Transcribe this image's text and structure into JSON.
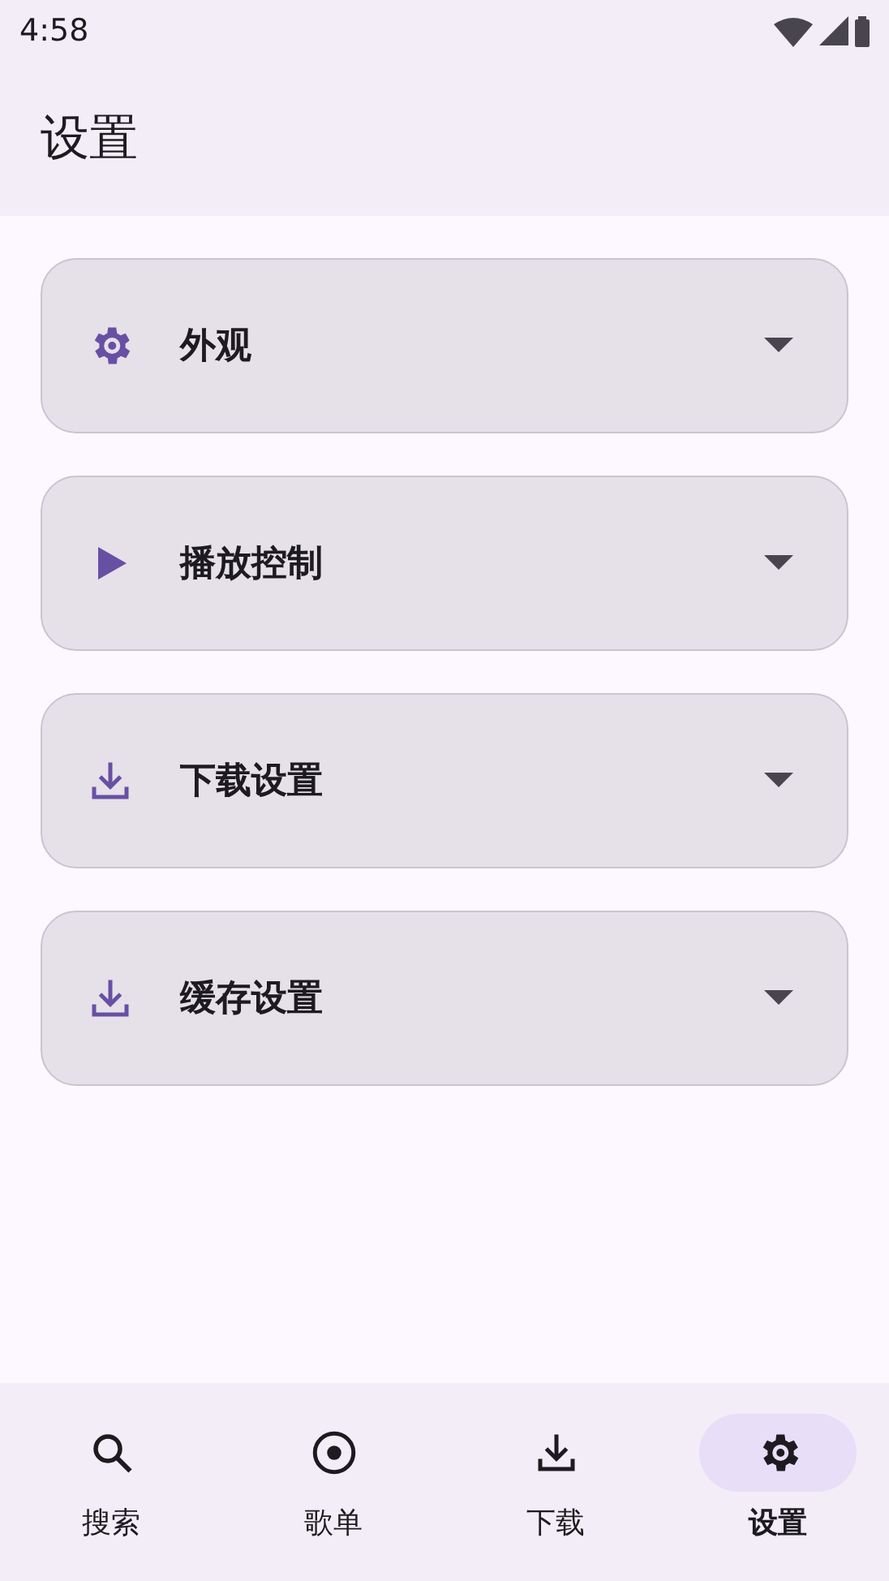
{
  "status_bar": {
    "time": "4:58"
  },
  "title": "设置",
  "sections": [
    {
      "label": "外观",
      "kind": "gear",
      "expanded": false
    },
    {
      "label": "播放控制",
      "kind": "play",
      "expanded": false
    },
    {
      "label": "下载设置",
      "kind": "download",
      "expanded": false
    },
    {
      "label": "缓存设置",
      "kind": "download",
      "expanded": false
    }
  ],
  "nav": [
    {
      "label": "搜索",
      "kind": "search",
      "selected": false
    },
    {
      "label": "歌单",
      "kind": "disc",
      "selected": false
    },
    {
      "label": "下载",
      "kind": "download",
      "selected": false
    },
    {
      "label": "设置",
      "kind": "gear",
      "selected": true
    }
  ]
}
